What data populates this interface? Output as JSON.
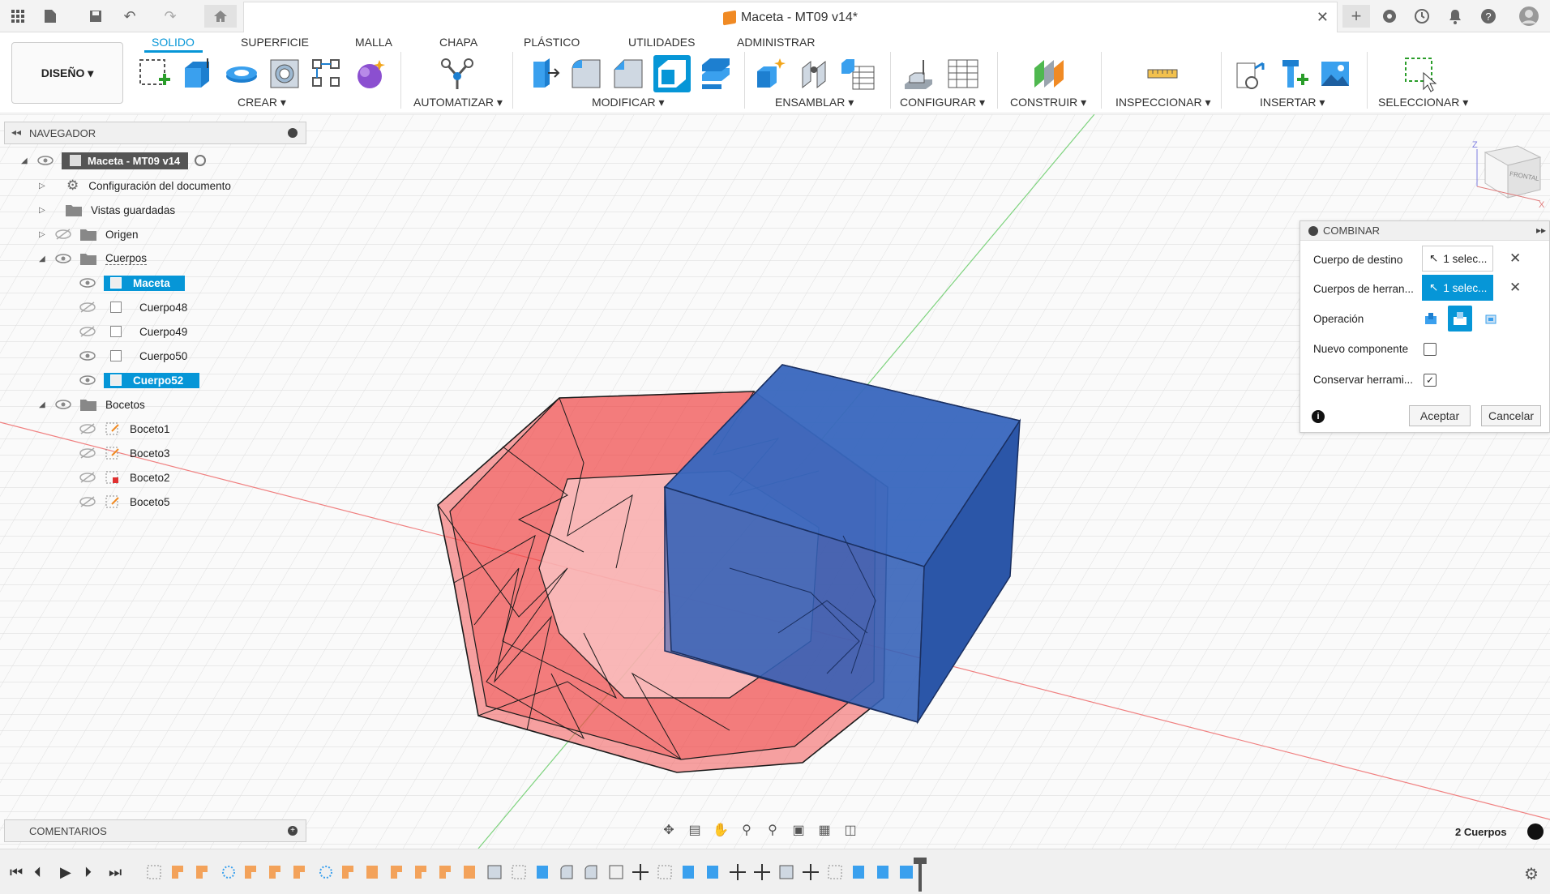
{
  "titlebar": {
    "doc_title": "Maceta - MT09 v14*",
    "close": "✕"
  },
  "ribbon": {
    "design_label": "DISEÑO ▾",
    "tabs": [
      "SOLIDO",
      "SUPERFICIE",
      "MALLA",
      "CHAPA",
      "PLÁSTICO",
      "UTILIDADES",
      "ADMINISTRAR"
    ],
    "groups": [
      "CREAR ▾",
      "AUTOMATIZAR ▾",
      "MODIFICAR ▾",
      "ENSAMBLAR ▾",
      "CONFIGURAR ▾",
      "CONSTRUIR ▾",
      "INSPECCIONAR ▾",
      "INSERTAR ▾",
      "SELECCIONAR ▾"
    ]
  },
  "navigator": {
    "title": "NAVEGADOR",
    "root": "Maceta - MT09 v14",
    "items": [
      {
        "label": "Configuración del documento"
      },
      {
        "label": "Vistas guardadas"
      },
      {
        "label": "Origen"
      },
      {
        "label": "Cuerpos"
      },
      {
        "label": "Maceta"
      },
      {
        "label": "Cuerpo48"
      },
      {
        "label": "Cuerpo49"
      },
      {
        "label": "Cuerpo50"
      },
      {
        "label": "Cuerpo52"
      },
      {
        "label": "Bocetos"
      },
      {
        "label": "Boceto1"
      },
      {
        "label": "Boceto3"
      },
      {
        "label": "Boceto2"
      },
      {
        "label": "Boceto5"
      }
    ]
  },
  "combine_panel": {
    "title": "COMBINAR",
    "target_label": "Cuerpo de destino",
    "target_value": "1 selec...",
    "tools_label": "Cuerpos de herran...",
    "tools_value": "1 selec...",
    "operation_label": "Operación",
    "new_component_label": "Nuevo componente",
    "new_component_checked": false,
    "keep_tools_label": "Conservar herrami...",
    "keep_tools_checked": true,
    "ok": "Aceptar",
    "cancel": "Cancelar"
  },
  "comments": {
    "title": "COMENTARIOS"
  },
  "status": {
    "bodies": "2 Cuerpos"
  },
  "viewcube": {
    "front": "FRONTAL"
  },
  "colors": {
    "accent": "#0696d7",
    "red_body": "#f03030",
    "blue_body": "#2f5fb5"
  }
}
